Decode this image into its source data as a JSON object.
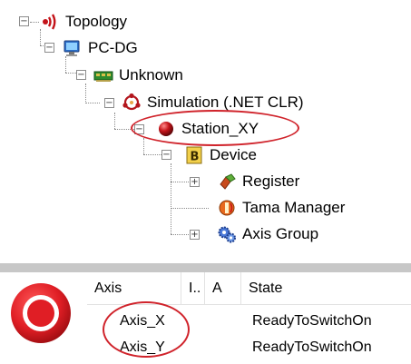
{
  "tree": {
    "root": {
      "label": "Topology",
      "icon": "topology-icon"
    },
    "pc": {
      "label": "PC-DG",
      "icon": "computer-icon"
    },
    "unknown": {
      "label": "Unknown",
      "icon": "board-icon"
    },
    "simulation": {
      "label": "Simulation (.NET CLR)",
      "icon": "simulation-icon"
    },
    "station": {
      "label": "Station_XY",
      "icon": "station-ball-icon",
      "highlighted": true
    },
    "device": {
      "label": "Device",
      "icon": "device-b-icon"
    },
    "register": {
      "label": "Register",
      "icon": "register-icon"
    },
    "tama": {
      "label": "Tama Manager",
      "icon": "tama-manager-icon"
    },
    "axis_group": {
      "label": "Axis Group",
      "icon": "gears-icon"
    },
    "expander_minus": "−",
    "expander_plus": "+"
  },
  "axis_table": {
    "status_icon": "stop-red-icon",
    "columns": [
      "Axis",
      "I..",
      "A",
      "State"
    ],
    "rows": [
      {
        "axis": "Axis_X",
        "i": "",
        "a": "",
        "state": "ReadyToSwitchOn"
      },
      {
        "axis": "Axis_Y",
        "i": "",
        "a": "",
        "state": "ReadyToSwitchOn"
      }
    ]
  },
  "colors": {
    "highlight_oval": "#d0232b",
    "separator": "#c7c7c7",
    "stop_red": "#e01e25"
  }
}
